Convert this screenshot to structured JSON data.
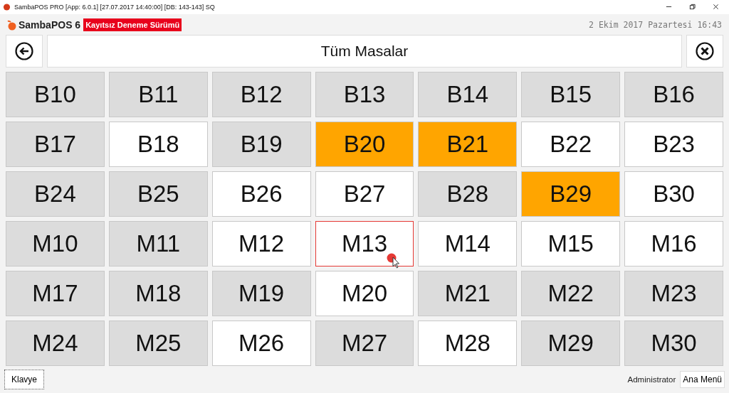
{
  "window": {
    "title": "SambaPOS PRO [App: 6.0.1] [27.07.2017 14:40:00] [DB: 143-143] SQ"
  },
  "header": {
    "app_name": "SambaPOS 6",
    "badge": "Kayıtsız Deneme Sürümü",
    "datetime": "2 Ekim 2017 Pazartesi 16:43"
  },
  "nav": {
    "title": "Tüm Masalar"
  },
  "tables": [
    {
      "label": "B10",
      "color": "#dcdcdc",
      "selected": false
    },
    {
      "label": "B11",
      "color": "#dcdcdc",
      "selected": false
    },
    {
      "label": "B12",
      "color": "#dcdcdc",
      "selected": false
    },
    {
      "label": "B13",
      "color": "#dcdcdc",
      "selected": false
    },
    {
      "label": "B14",
      "color": "#dcdcdc",
      "selected": false
    },
    {
      "label": "B15",
      "color": "#dcdcdc",
      "selected": false
    },
    {
      "label": "B16",
      "color": "#dcdcdc",
      "selected": false
    },
    {
      "label": "B17",
      "color": "#dcdcdc",
      "selected": false
    },
    {
      "label": "B18",
      "color": "#ffffff",
      "selected": false
    },
    {
      "label": "B19",
      "color": "#dcdcdc",
      "selected": false
    },
    {
      "label": "B20",
      "color": "#ffa500",
      "selected": false
    },
    {
      "label": "B21",
      "color": "#ffa500",
      "selected": false
    },
    {
      "label": "B22",
      "color": "#ffffff",
      "selected": false
    },
    {
      "label": "B23",
      "color": "#ffffff",
      "selected": false
    },
    {
      "label": "B24",
      "color": "#dcdcdc",
      "selected": false
    },
    {
      "label": "B25",
      "color": "#dcdcdc",
      "selected": false
    },
    {
      "label": "B26",
      "color": "#ffffff",
      "selected": false
    },
    {
      "label": "B27",
      "color": "#ffffff",
      "selected": false
    },
    {
      "label": "B28",
      "color": "#dcdcdc",
      "selected": false
    },
    {
      "label": "B29",
      "color": "#ffa500",
      "selected": false
    },
    {
      "label": "B30",
      "color": "#ffffff",
      "selected": false
    },
    {
      "label": "M10",
      "color": "#dcdcdc",
      "selected": false
    },
    {
      "label": "M11",
      "color": "#dcdcdc",
      "selected": false
    },
    {
      "label": "M12",
      "color": "#ffffff",
      "selected": false
    },
    {
      "label": "M13",
      "color": "#ffffff",
      "selected": true
    },
    {
      "label": "M14",
      "color": "#ffffff",
      "selected": false
    },
    {
      "label": "M15",
      "color": "#ffffff",
      "selected": false
    },
    {
      "label": "M16",
      "color": "#ffffff",
      "selected": false
    },
    {
      "label": "M17",
      "color": "#dcdcdc",
      "selected": false
    },
    {
      "label": "M18",
      "color": "#dcdcdc",
      "selected": false
    },
    {
      "label": "M19",
      "color": "#dcdcdc",
      "selected": false
    },
    {
      "label": "M20",
      "color": "#ffffff",
      "selected": false
    },
    {
      "label": "M21",
      "color": "#dcdcdc",
      "selected": false
    },
    {
      "label": "M22",
      "color": "#dcdcdc",
      "selected": false
    },
    {
      "label": "M23",
      "color": "#dcdcdc",
      "selected": false
    },
    {
      "label": "M24",
      "color": "#dcdcdc",
      "selected": false
    },
    {
      "label": "M25",
      "color": "#dcdcdc",
      "selected": false
    },
    {
      "label": "M26",
      "color": "#ffffff",
      "selected": false
    },
    {
      "label": "M27",
      "color": "#dcdcdc",
      "selected": false
    },
    {
      "label": "M28",
      "color": "#ffffff",
      "selected": false
    },
    {
      "label": "M29",
      "color": "#dcdcdc",
      "selected": false
    },
    {
      "label": "M30",
      "color": "#dcdcdc",
      "selected": false
    }
  ],
  "footer": {
    "keyboard_button": "Klavye",
    "user": "Administrator",
    "menu_button": "Ana Menü"
  }
}
